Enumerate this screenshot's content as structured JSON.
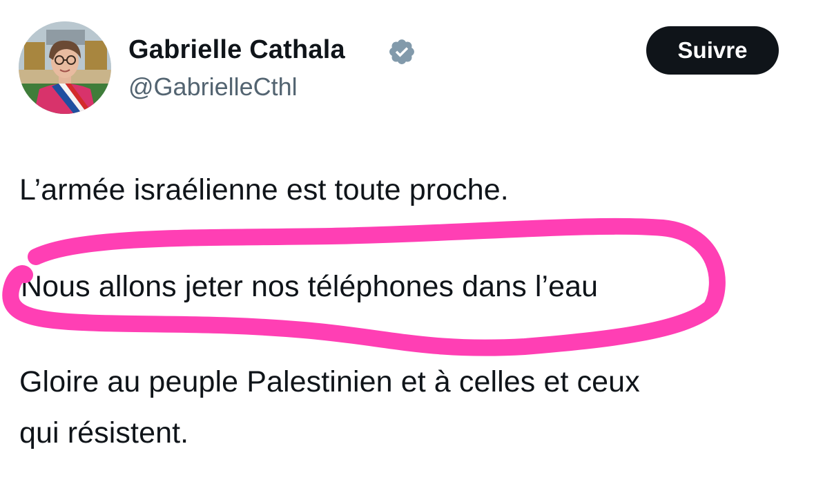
{
  "author": {
    "display_name": "Gabrielle Cathala",
    "handle": "@GabrielleCthl",
    "verified": true,
    "avatar_icon": "profile-photo-avatar"
  },
  "follow_button": {
    "label": "Suivre"
  },
  "tweet": {
    "lines": [
      "L’armée israélienne est toute proche.",
      "Nous allons jeter nos téléphones dans l’eau",
      "Gloire au peuple Palestinien et à  celles et ceux",
      "qui résistent."
    ]
  },
  "colors": {
    "text": "#0f1419",
    "handle": "#536471",
    "button_bg": "#0f1419",
    "verified_badge": "#829aab",
    "annotation_stroke": "#ff3fb4"
  }
}
